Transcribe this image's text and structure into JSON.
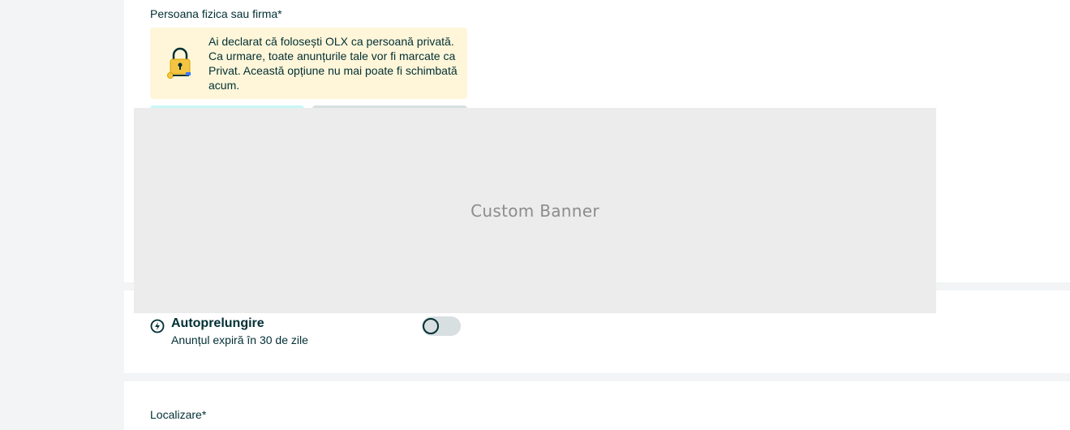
{
  "seller_type": {
    "label": "Persoana fizica sau firma*",
    "notice_text": "Ai declarat că folosești OLX ca persoană privată. Ca urmare, toate anunțurile tale vor fi marcate ca Privat. Această opțiune nu mai poate fi schimbată acum.",
    "notice_icon": "lock-icon"
  },
  "banner": {
    "text": "Custom Banner"
  },
  "auto_renew": {
    "icon": "auto-renew-icon",
    "title": "Autoprelungire",
    "subtitle": "Anunțul expiră în 30 de zile",
    "enabled": false
  },
  "location": {
    "label": "Localizare*"
  },
  "colors": {
    "page_bg": "#f2f4f5",
    "card_bg": "#ffffff",
    "notice_bg": "#fff6d9",
    "text": "#002f34",
    "banner_bg": "#ececec"
  }
}
